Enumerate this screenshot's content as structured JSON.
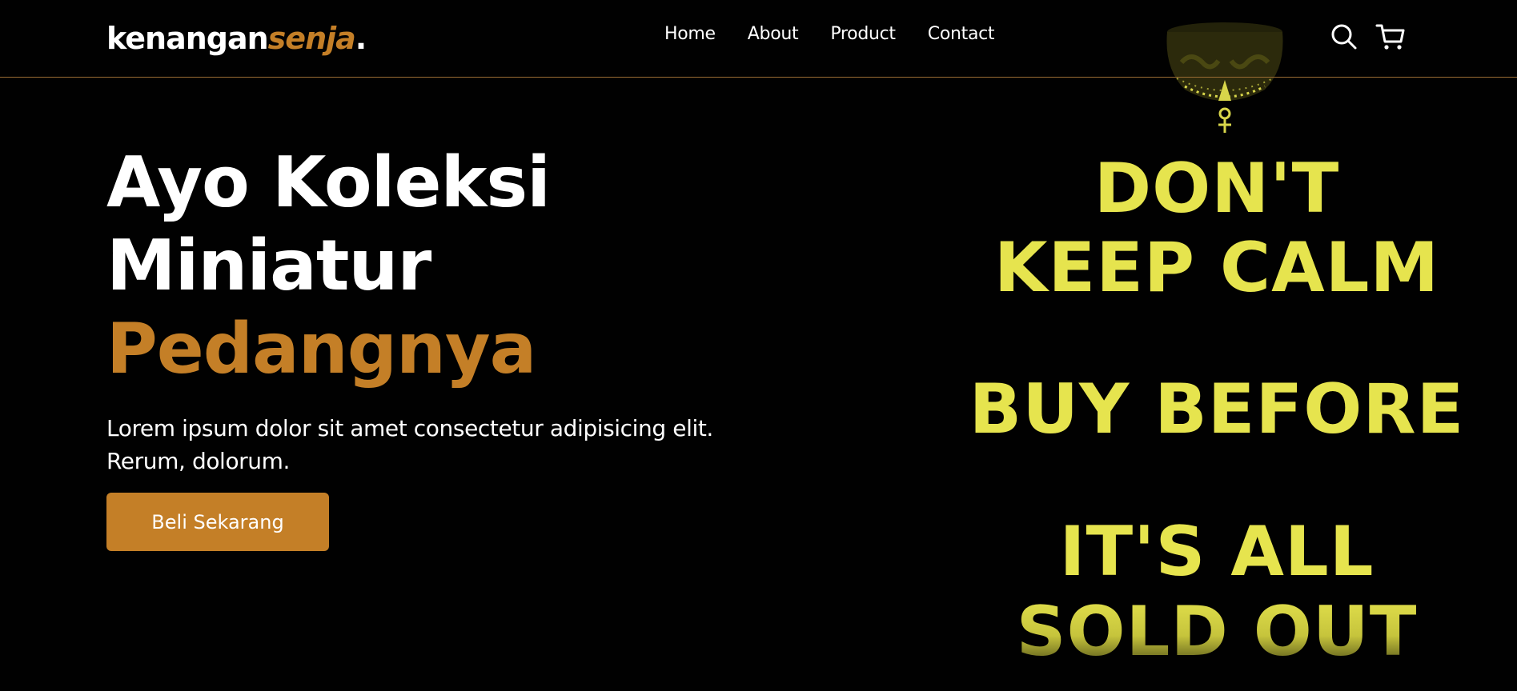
{
  "brand": {
    "name_main": "kenangan",
    "name_accent": "senja",
    "name_dot": "."
  },
  "nav": {
    "links": [
      "Home",
      "About",
      "Product",
      "Contact"
    ],
    "icons": [
      "search-icon",
      "cart-icon"
    ]
  },
  "hero": {
    "title_line1": "Ayo Koleksi",
    "title_line2": "Miniatur",
    "title_line3": "Pedangnya",
    "description": "Lorem ipsum dolor sit amet consectetur adipisicing elit. Rerum, dolorum.",
    "cta_label": "Beli Sekarang"
  },
  "poster": {
    "line1": "DON'T",
    "line2": "KEEP CALM",
    "line3": "BUY BEFORE",
    "line4": "IT'S ALL",
    "line5": "SOLD OUT"
  },
  "colors": {
    "background": "#010101",
    "accent": "#c47f27",
    "poster_text": "#e6e44e",
    "divider": "#9a6c33"
  }
}
